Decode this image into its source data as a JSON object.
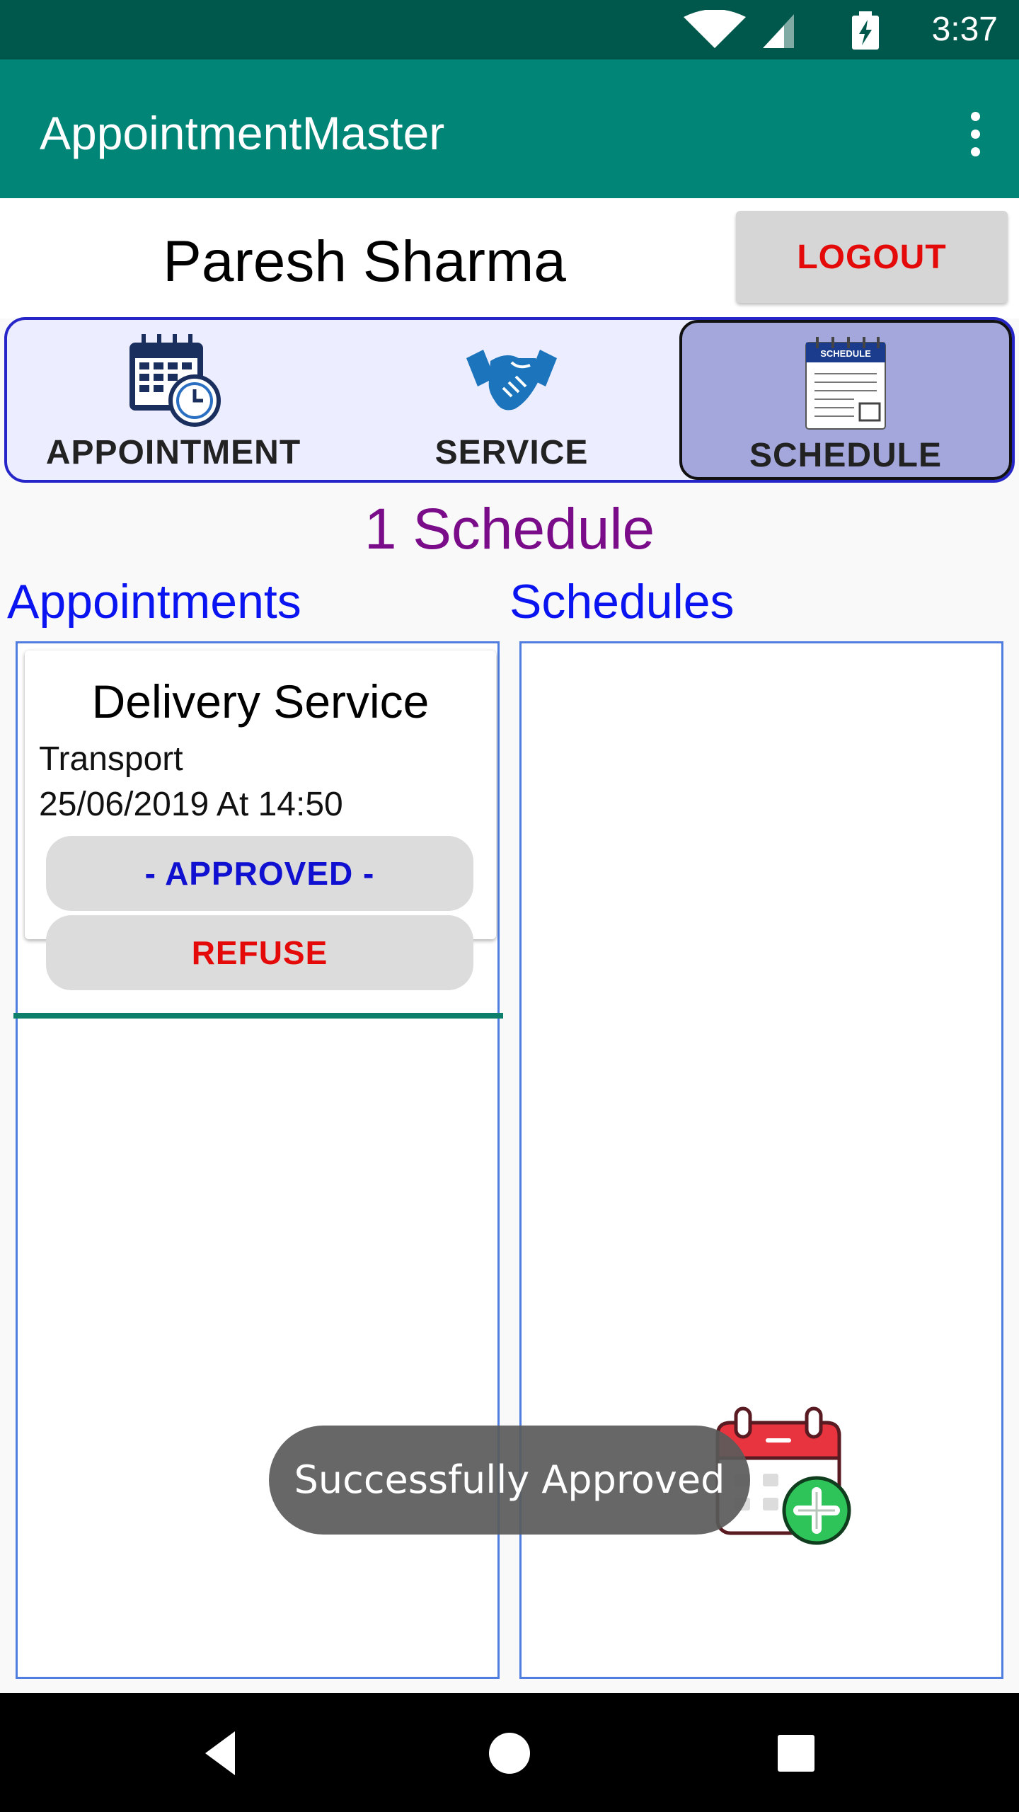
{
  "status_bar": {
    "time": "3:37",
    "icons": [
      "wifi-icon",
      "cell-signal-icon",
      "battery-charging-icon"
    ]
  },
  "app_bar": {
    "title": "AppointmentMaster",
    "menu_icon": "overflow-menu-icon"
  },
  "user": {
    "name": "Paresh Sharma",
    "logout_label": "LOGOUT"
  },
  "tabs": [
    {
      "label": "APPOINTMENT",
      "icon": "calendar-clock-icon",
      "active": false
    },
    {
      "label": "SERVICE",
      "icon": "handshake-icon",
      "active": false
    },
    {
      "label": "SCHEDULE",
      "icon": "schedule-notepad-icon",
      "icon_text": "SCHEDULE",
      "active": true
    }
  ],
  "section_title": "1 Schedule",
  "columns": {
    "appointments": "Appointments",
    "schedules": "Schedules"
  },
  "appointment": {
    "title": "Delivery Service",
    "category": "Transport",
    "datetime": "25/06/2019 At 14:50",
    "approve_label": "- APPROVED -",
    "refuse_label": "REFUSE"
  },
  "fab_icon": "calendar-add-icon",
  "toast": "Successfully Approved",
  "nav": [
    "back-icon",
    "home-icon",
    "recents-icon"
  ],
  "colors": {
    "status_bar": "#00574b",
    "app_bar": "#008577",
    "logout": "#e50a0a",
    "section_title": "#7a0c8a",
    "headings": "#0a14f0",
    "approved": "#1010d0",
    "refuse": "#e50a0a",
    "active_tab": "#a3a7dc"
  }
}
